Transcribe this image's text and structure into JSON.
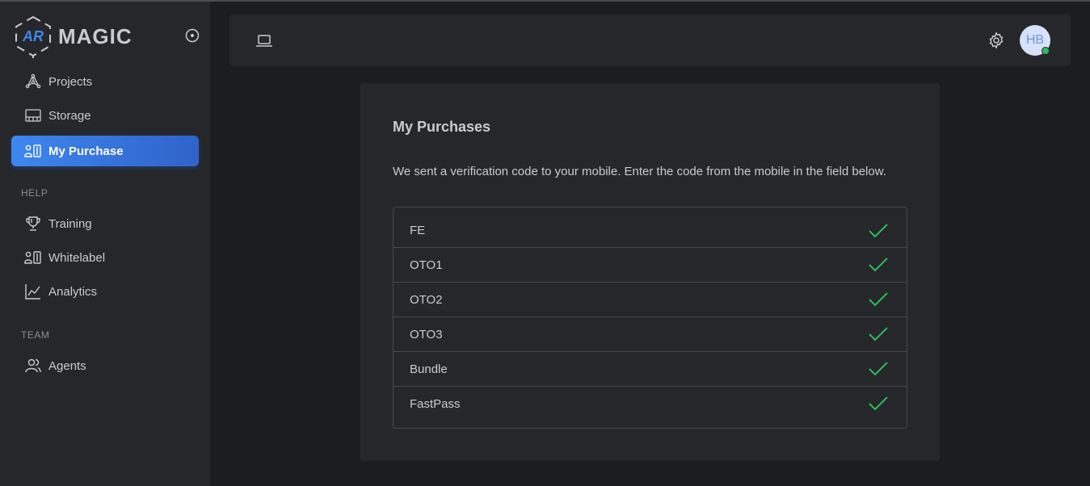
{
  "app": {
    "logo_text": "MAGIC",
    "logo_mark": "AR"
  },
  "sidebar": {
    "items": [
      {
        "label": "Projects",
        "icon": "projects-icon"
      },
      {
        "label": "Storage",
        "icon": "storage-icon"
      },
      {
        "label": "My Purchase",
        "icon": "purchase-icon",
        "active": true
      }
    ],
    "help_label": "HELP",
    "help_items": [
      {
        "label": "Training",
        "icon": "trophy-icon"
      },
      {
        "label": "Whitelabel",
        "icon": "whitelabel-icon"
      },
      {
        "label": "Analytics",
        "icon": "analytics-icon"
      }
    ],
    "team_label": "TEAM",
    "team_items": [
      {
        "label": "Agents",
        "icon": "users-icon"
      }
    ]
  },
  "topbar": {
    "avatar_initials": "HB",
    "status": "online"
  },
  "card": {
    "title": "My Purchases",
    "description": "We sent a verification code to your mobile. Enter the code from the mobile in the field below.",
    "items": [
      {
        "label": "FE",
        "checked": true
      },
      {
        "label": "OTO1",
        "checked": true
      },
      {
        "label": "OTO2",
        "checked": true
      },
      {
        "label": "OTO3",
        "checked": true
      },
      {
        "label": "Bundle",
        "checked": true
      },
      {
        "label": "FastPass",
        "checked": true
      }
    ]
  },
  "colors": {
    "accent": "#3e86ef",
    "check": "#2dbb5d",
    "background": "#1c1d1f",
    "panel": "#25272a"
  }
}
